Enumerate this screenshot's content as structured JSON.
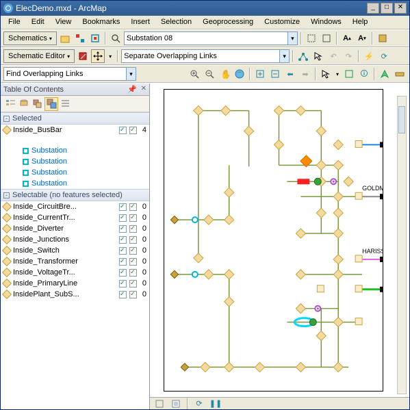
{
  "window": {
    "title": "ElecDemo.mxd - ArcMap"
  },
  "menubar": [
    "File",
    "Edit",
    "View",
    "Bookmarks",
    "Insert",
    "Selection",
    "Geoprocessing",
    "Customize",
    "Windows",
    "Help"
  ],
  "tb1": {
    "schematics_label": "Schematics",
    "layer_value": "Substation 08"
  },
  "tb2": {
    "editor_label": "Schematic Editor",
    "task_value": "Separate Overlapping Links"
  },
  "tb3": {
    "find_value": "Find Overlapping Links"
  },
  "toc": {
    "title": "Table Of Contents",
    "sections": {
      "selected": "Selected",
      "selectable": "Selectable (no features selected)"
    },
    "selected_layer": {
      "name": "Inside_BusBar",
      "count": "4"
    },
    "sub_items": [
      "Substation",
      "Substation",
      "Substation",
      "Substation"
    ],
    "selectable_layers": [
      {
        "name": "Inside_CircuitBre...",
        "count": "0"
      },
      {
        "name": "Inside_CurrentTr...",
        "count": "0"
      },
      {
        "name": "Inside_Diverter",
        "count": "0"
      },
      {
        "name": "Inside_Junctions",
        "count": "0"
      },
      {
        "name": "Inside_Switch",
        "count": "0"
      },
      {
        "name": "Inside_Transformer",
        "count": "0"
      },
      {
        "name": "Inside_VoltageTr...",
        "count": "0"
      },
      {
        "name": "Inside_PrimaryLine",
        "count": "0"
      },
      {
        "name": "InsidePlant_SubS...",
        "count": "0"
      }
    ]
  },
  "map": {
    "labels": [
      "GOLDMINE",
      "HARISSON"
    ]
  },
  "winbtns": {
    "min": "_",
    "max": "□",
    "close": "✕"
  }
}
